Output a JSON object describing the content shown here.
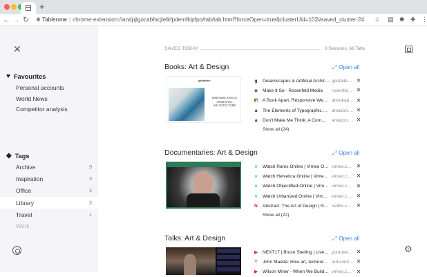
{
  "browser": {
    "url_site": "Tablerone",
    "url_path": "chrome-extension://andpjlgocabfacjlelkfpdemfklpfpo/tab/tab.html?forceOpen=true&clusterUid=102#saved_cluster-24",
    "new_tab_label": "+"
  },
  "sidebar": {
    "favourites_title": "Favourites",
    "favourites": [
      "Personal accounts",
      "World News",
      "Competitor analysis"
    ],
    "tags_title": "Tags",
    "tags": [
      {
        "label": "Archive",
        "count": "9"
      },
      {
        "label": "Inspiration",
        "count": "3"
      },
      {
        "label": "Office",
        "count": "3"
      },
      {
        "label": "Library",
        "count": "3"
      },
      {
        "label": "Travel",
        "count": "1"
      },
      {
        "label": "Work",
        "count": ""
      }
    ],
    "active_tag": "Library"
  },
  "main": {
    "saved_label": "SAVED TODAY",
    "saved_count": "3 Sessions, 66 Tabs",
    "open_all_label": "Open all",
    "clusters": [
      {
        "title": "Books: Art & Design",
        "show_all": "Show all (24)",
        "links": [
          {
            "icon": "gestalten-icon",
            "glyph": "g",
            "color": "#222",
            "title": "Dreamscapes & Artificial Archite…",
            "domain": "gestalte…"
          },
          {
            "icon": "rosenfeld-icon",
            "glyph": "◆",
            "color": "#3c7ab3",
            "title": "Make It So - Rosenfeld Media",
            "domain": "rosenfel…"
          },
          {
            "icon": "abookapart-icon",
            "glyph": "◩",
            "color": "#6c8a3a",
            "title": "A Book Apart, Responsive Web D…",
            "domain": "abookap…"
          },
          {
            "icon": "amazon-icon",
            "glyph": "a",
            "color": "#222",
            "title": "The Elements of Typographic Sty…",
            "domain": "amazon.…"
          },
          {
            "icon": "amazon-icon",
            "glyph": "a",
            "color": "#222",
            "title": "Don't Make Me Think: A Common…",
            "domain": "amazon.…"
          }
        ],
        "thumb_title": "DREAMSCAPES & ARTIFICIAL ARCHITECTURE",
        "thumb_brand": "gestalten"
      },
      {
        "title": "Documentaries: Art & Design",
        "show_all": "Show all (22)",
        "links": [
          {
            "icon": "vimeo-icon",
            "glyph": "v",
            "color": "#1ab7ea",
            "title": "Watch Rams Online | Vimeo On D…",
            "domain": "vimeo.c…"
          },
          {
            "icon": "vimeo-icon",
            "glyph": "v",
            "color": "#1ab7ea",
            "title": "Watch Helvetica Online | Vimeo …",
            "domain": "vimeo.c…"
          },
          {
            "icon": "vimeo-icon",
            "glyph": "v",
            "color": "#1ab7ea",
            "title": "Watch Objectified Online | Vimeo…",
            "domain": "vimeo.c…"
          },
          {
            "icon": "vimeo-icon",
            "glyph": "v",
            "color": "#1ab7ea",
            "title": "Watch Urbanized Online | Vimeo …",
            "domain": "vimeo.c…"
          },
          {
            "icon": "netflix-icon",
            "glyph": "N",
            "color": "#e50914",
            "title": "Abstract: The Art of Design | Net…",
            "domain": "netflix.c…"
          }
        ]
      },
      {
        "title": "Talks: Art & Design",
        "links": [
          {
            "icon": "youtube-icon",
            "glyph": "▶",
            "color": "#e52d27",
            "title": "NEXT17 | Bruce Sterling | Live fro…",
            "domain": "youtube…"
          },
          {
            "icon": "ted-icon",
            "glyph": "T",
            "color": "#e62b1e",
            "title": "John Maeda: How art, technolog…",
            "domain": "ted.com/…"
          },
          {
            "icon": "youtube-icon",
            "glyph": "▶",
            "color": "#e52d27",
            "title": "Wilson Miner - When We Build | …",
            "domain": "vimeo.c…"
          }
        ]
      }
    ]
  }
}
